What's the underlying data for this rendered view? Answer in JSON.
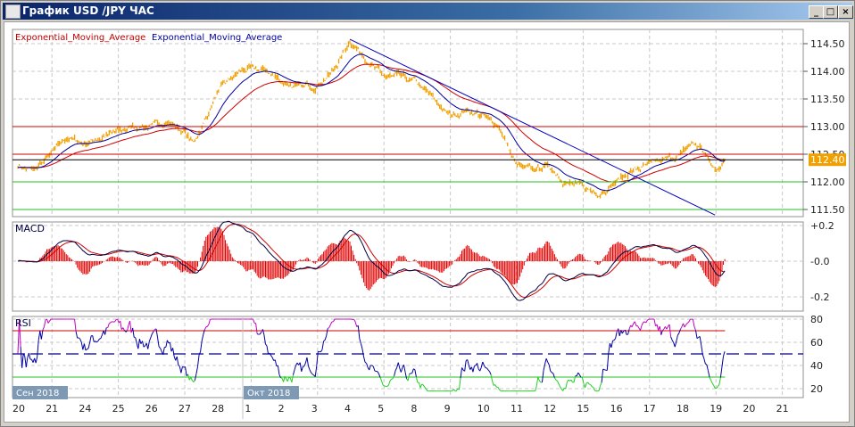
{
  "window": {
    "title": "График USD /JPY  ЧАС",
    "minimize": "_",
    "maximize": "□",
    "close": "×"
  },
  "legend": {
    "ema1": "Exponential_Moving_Average",
    "ema2": "Exponential_Moving_Average"
  },
  "colors": {
    "price": "#f0a000",
    "ema_fast": "#0000a0",
    "ema_slow": "#d00000",
    "resistance": "#d00000",
    "support": "#20c020",
    "current": "#000000",
    "trend": "#0000c0"
  },
  "chart_data": [
    {
      "type": "line",
      "title": "USD/JPY hourly",
      "price_ticks": [
        "114.50",
        "114.00",
        "113.50",
        "113.00",
        "112.50",
        "112.00",
        "111.50"
      ],
      "price_tick_values": [
        114.5,
        114.0,
        113.5,
        113.0,
        112.5,
        112.0,
        111.5
      ],
      "ylim": [
        111.3,
        114.75
      ],
      "current_price": "112.40",
      "horizontal_levels": {
        "resistance": [
          113.0,
          112.5
        ],
        "current": 112.4,
        "support": [
          112.0,
          111.5
        ]
      },
      "trendline": {
        "from": [
          10,
          114.58
        ],
        "to": [
          21,
          111.4
        ]
      },
      "price_anchors": [
        [
          0,
          112.3
        ],
        [
          0.5,
          112.2
        ],
        [
          1,
          112.5
        ],
        [
          1.5,
          112.8
        ],
        [
          2,
          112.7
        ],
        [
          2.5,
          112.8
        ],
        [
          3,
          112.9
        ],
        [
          3.5,
          113.0
        ],
        [
          4,
          113.0
        ],
        [
          4.5,
          113.1
        ],
        [
          5,
          112.9
        ],
        [
          5.3,
          112.7
        ],
        [
          5.7,
          113.2
        ],
        [
          6,
          113.6
        ],
        [
          6.3,
          113.8
        ],
        [
          6.7,
          114.0
        ],
        [
          7,
          114.05
        ],
        [
          7.5,
          114.0
        ],
        [
          8,
          113.8
        ],
        [
          8.5,
          113.7
        ],
        [
          9,
          113.75
        ],
        [
          9.5,
          114.0
        ],
        [
          10,
          114.55
        ],
        [
          10.4,
          114.3
        ],
        [
          10.7,
          114.1
        ],
        [
          11,
          113.9
        ],
        [
          11.5,
          113.9
        ],
        [
          12,
          113.8
        ],
        [
          12.5,
          113.5
        ],
        [
          13,
          113.2
        ],
        [
          13.5,
          113.3
        ],
        [
          14,
          113.2
        ],
        [
          14.5,
          113.0
        ],
        [
          15,
          112.3
        ],
        [
          15.5,
          112.2
        ],
        [
          16,
          112.3
        ],
        [
          16.5,
          112.0
        ],
        [
          17,
          111.9
        ],
        [
          17.5,
          111.8
        ],
        [
          18,
          112.0
        ],
        [
          18.5,
          112.2
        ],
        [
          19,
          112.3
        ],
        [
          19.5,
          112.4
        ],
        [
          20,
          112.5
        ],
        [
          20.3,
          112.7
        ],
        [
          20.6,
          112.6
        ],
        [
          21,
          112.2
        ],
        [
          21.3,
          112.4
        ]
      ]
    },
    {
      "type": "line",
      "title": "MACD",
      "ticks": [
        "+0.2",
        "-0.0",
        "-0.2"
      ],
      "tick_values": [
        0.2,
        0,
        -0.2
      ],
      "ylim": [
        -0.3,
        0.25
      ]
    },
    {
      "type": "line",
      "title": "RSI",
      "ticks": [
        "80",
        "60",
        "40",
        "20"
      ],
      "tick_values": [
        80,
        60,
        40,
        20
      ],
      "levels": [
        70,
        50,
        30
      ],
      "ylim": [
        15,
        85
      ]
    }
  ],
  "xaxis": {
    "labels": [
      "20",
      "21",
      "24",
      "25",
      "26",
      "27",
      "28",
      "1",
      "2",
      "3",
      "4",
      "5",
      "8",
      "9",
      "10",
      "11",
      "12",
      "15",
      "16",
      "17",
      "18",
      "19",
      "20",
      "21"
    ],
    "months": [
      "Сен 2018",
      "Окт 2018"
    ]
  }
}
